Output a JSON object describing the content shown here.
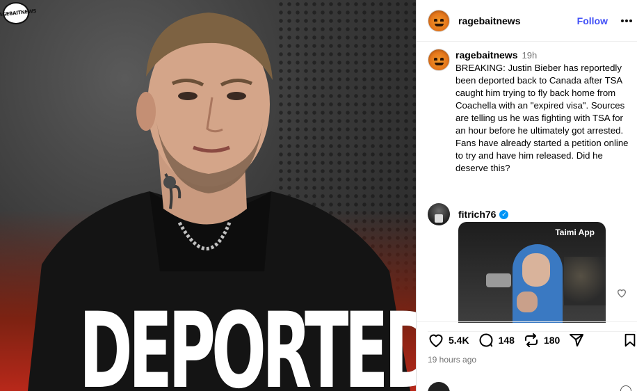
{
  "media": {
    "brand_badge": "RAGEBAITNEWS",
    "headline": "DEPORTED"
  },
  "header": {
    "username": "ragebaitnews",
    "follow_label": "Follow"
  },
  "caption": {
    "username": "ragebaitnews",
    "time": "19h",
    "text": "BREAKING: Justin Bieber has reportedly been deported back to Canada after TSA caught him trying to fly back home from Coachella with an \"expired visa\". Sources are telling us he was fighting with TSA for an hour before he ultimately got arrested. Fans have already started a petition online to try and have him released. Did he deserve this?"
  },
  "comment": {
    "username": "fitrich76",
    "verified": true,
    "media_tag": "Taimi App"
  },
  "actions": {
    "likes": "5.4K",
    "comments": "148",
    "reposts": "180",
    "posted_ago": "19 hours ago"
  },
  "colors": {
    "follow": "#4150f7",
    "verified": "#0095f6",
    "muted_text": "#737373"
  }
}
